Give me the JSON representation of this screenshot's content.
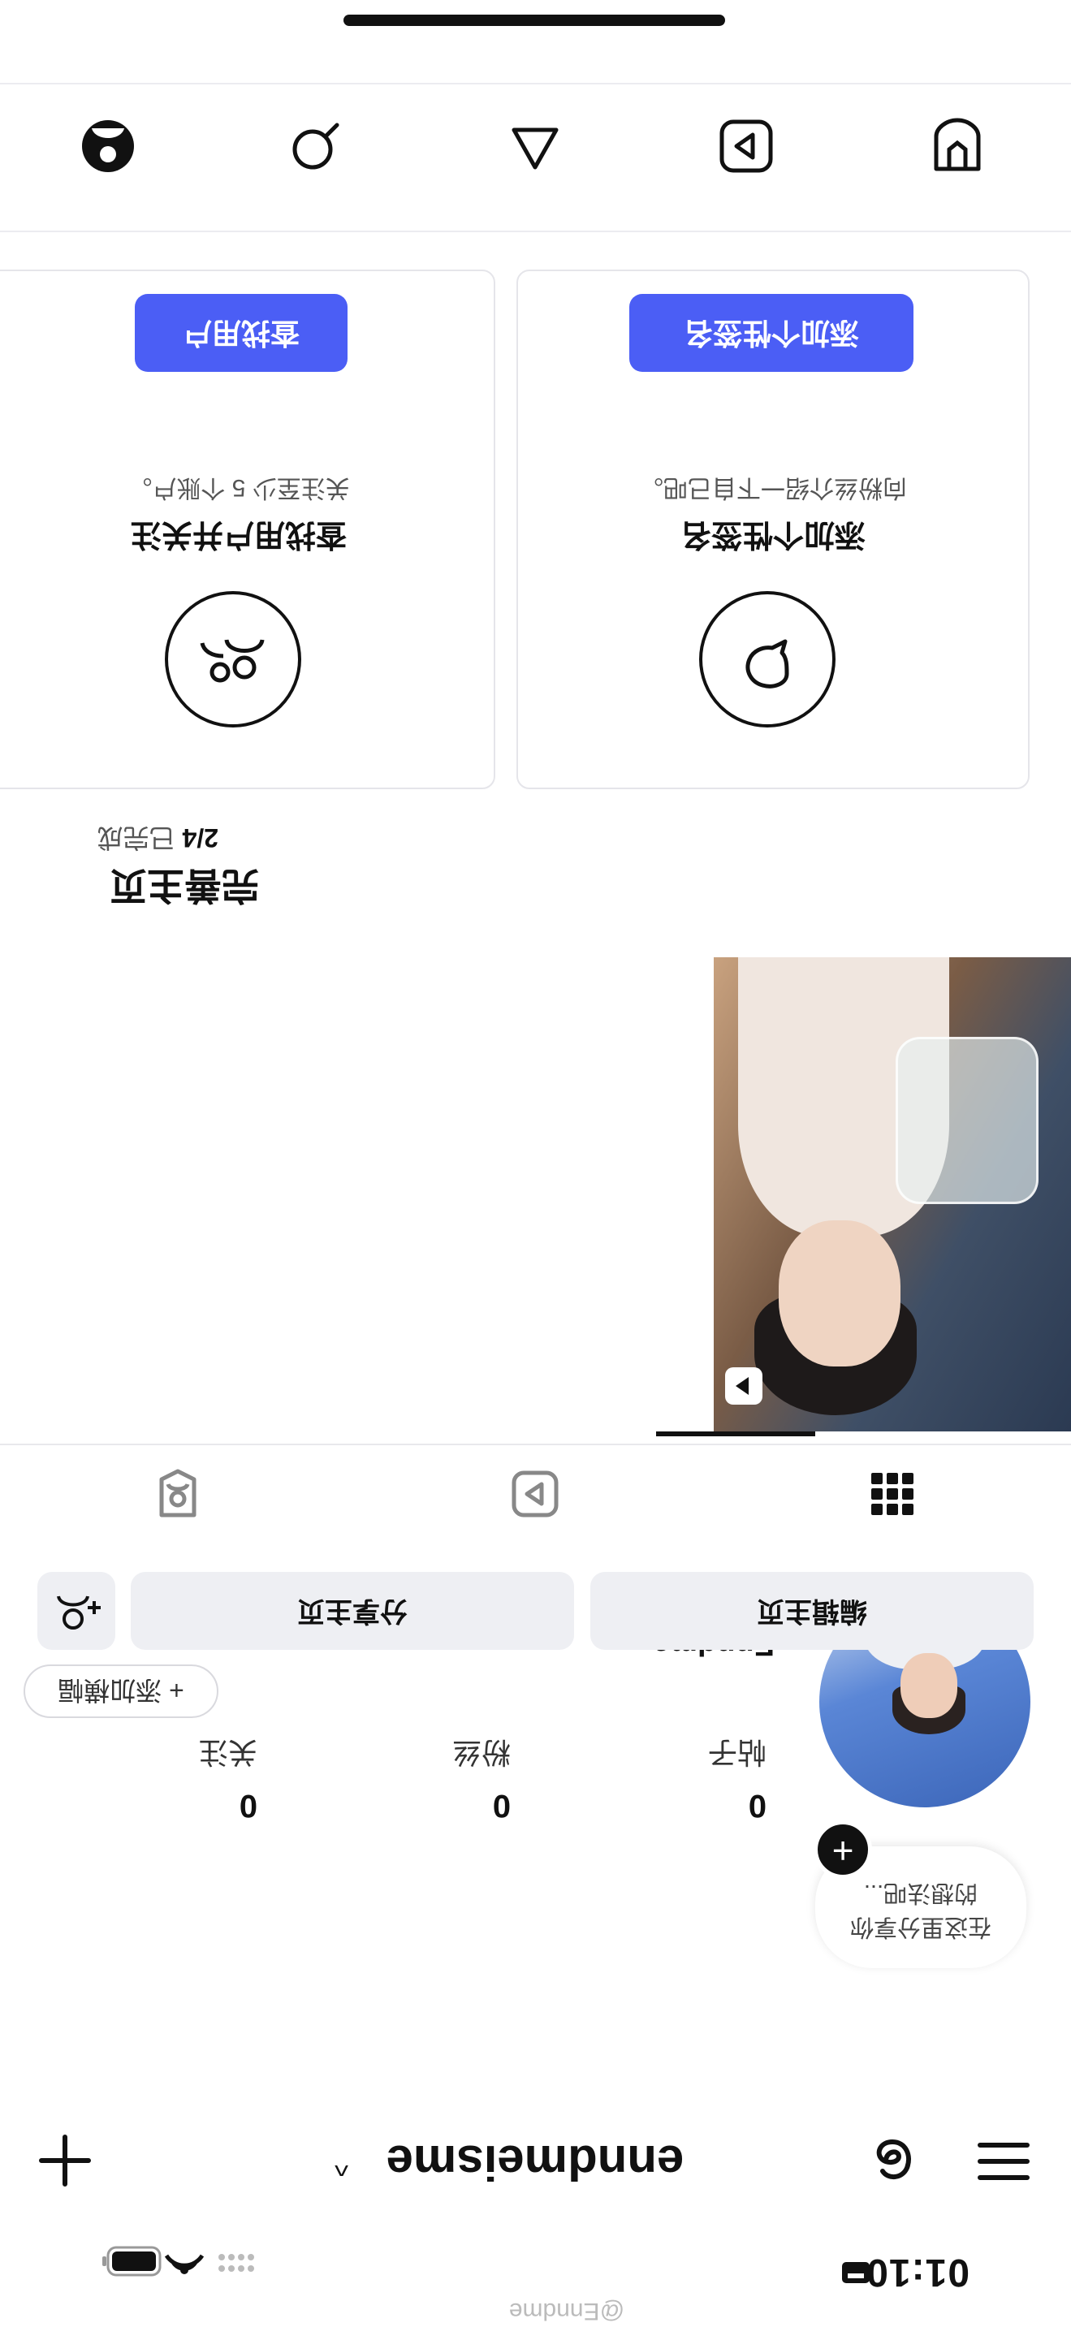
{
  "status_bar": {
    "time": "01:10"
  },
  "header": {
    "username": "enndmeisme",
    "chevron": "^",
    "add_icon": "plus-icon",
    "threads_icon": "threads-icon",
    "menu_icon": "hamburger-menu-icon"
  },
  "profile": {
    "display_name": "Enndme",
    "note_bubble": [
      "在这里分享你",
      "的想法吧..."
    ],
    "add_story": "+",
    "stats": [
      {
        "value": "0",
        "label": "帖子"
      },
      {
        "value": "0",
        "label": "粉丝"
      },
      {
        "value": "0",
        "label": "关注"
      }
    ],
    "add_banner": "+ 添加横幅",
    "edit_profile": "编辑主页",
    "share_profile": "分享主页"
  },
  "tabs": [
    {
      "icon": "grid-icon",
      "active": true
    },
    {
      "icon": "reels-icon",
      "active": false
    },
    {
      "icon": "tagged-icon",
      "active": false
    }
  ],
  "completion": {
    "title": "完善主页",
    "progress": "2/4",
    "progress_label": "已完成",
    "cards": [
      {
        "icon": "speech-bubble-icon",
        "title": "添加个性签名",
        "desc": "向粉丝介绍一下自己吧。",
        "button": "添加个性签名"
      },
      {
        "icon": "people-icon",
        "title": "查找用户并关注",
        "desc": "关注至少 5 个账户。",
        "button": "查找用户"
      }
    ]
  },
  "bottom_nav": [
    {
      "icon": "home-icon"
    },
    {
      "icon": "search-icon"
    },
    {
      "icon": "create-icon"
    },
    {
      "icon": "reels-icon"
    },
    {
      "icon": "profile-icon"
    }
  ],
  "watermark": "@Enndme",
  "colors": {
    "accent": "#4b5ef5",
    "button_bg": "#eeeff3",
    "text": "#111111"
  }
}
